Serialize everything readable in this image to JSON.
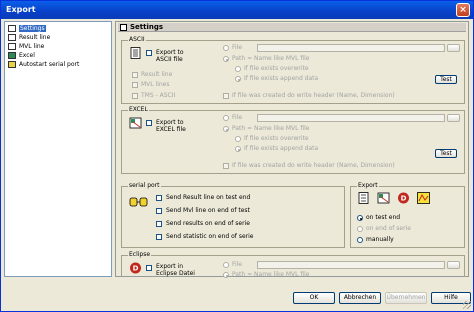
{
  "window": {
    "title": "Export",
    "close_label": "×"
  },
  "tree": {
    "items": [
      {
        "label": "Settings",
        "icon": "settings-icon",
        "selected": true
      },
      {
        "label": "Result line",
        "icon": "document-icon"
      },
      {
        "label": "MVL line",
        "icon": "document-icon"
      },
      {
        "label": "Excel",
        "icon": "excel-icon"
      },
      {
        "label": "Autostart serial port",
        "icon": "serial-port-icon"
      }
    ]
  },
  "panel": {
    "title": "Settings"
  },
  "ascii": {
    "group_label": "ASCII",
    "export_label": "Export to ASCII file",
    "options": [
      "Result line",
      "MVL lines",
      "TMS - ASCII"
    ],
    "file_label": "File",
    "path_label": "Path = Name like MVL file",
    "sub_options": [
      "If file exists overwrite",
      "If file exists append data"
    ],
    "header_label": "If file was created do write header (Name, Dimension)",
    "test_label": "Test"
  },
  "excel": {
    "group_label": "EXCEL",
    "export_label": "Export to EXCEL file",
    "file_label": "File",
    "path_label": "Path = Name like MVL file",
    "sub_options": [
      "If file exists overwrite",
      "If file exists append data"
    ],
    "header_label": "If file was created do write header (Name, Dimension)",
    "test_label": "Test"
  },
  "serial": {
    "group_label": "serial port",
    "options": [
      "Send Result line on test end",
      "Send Mvl line on end of test",
      "Send results on end of serie",
      "Send statistic on end of serie"
    ]
  },
  "export": {
    "group_label": "Export",
    "radios": [
      {
        "label": "on test end",
        "selected": true,
        "disabled": false
      },
      {
        "label": "on end of serie",
        "selected": false,
        "disabled": true
      },
      {
        "label": "manually",
        "selected": false,
        "disabled": false
      }
    ]
  },
  "eclipse": {
    "group_label": "Eclipse",
    "export_label": "Export in Eclipse Datei",
    "file_label": "File",
    "path_label": "Path = Name like MVL file"
  },
  "buttons": {
    "ok": "OK",
    "cancel": "Abbrechen",
    "apply": "Übernehmen",
    "help": "Hilfe"
  },
  "colors": {
    "title_bar": "#0A5FE8",
    "selection": "#316AC5",
    "background": "#ECE9D8"
  }
}
